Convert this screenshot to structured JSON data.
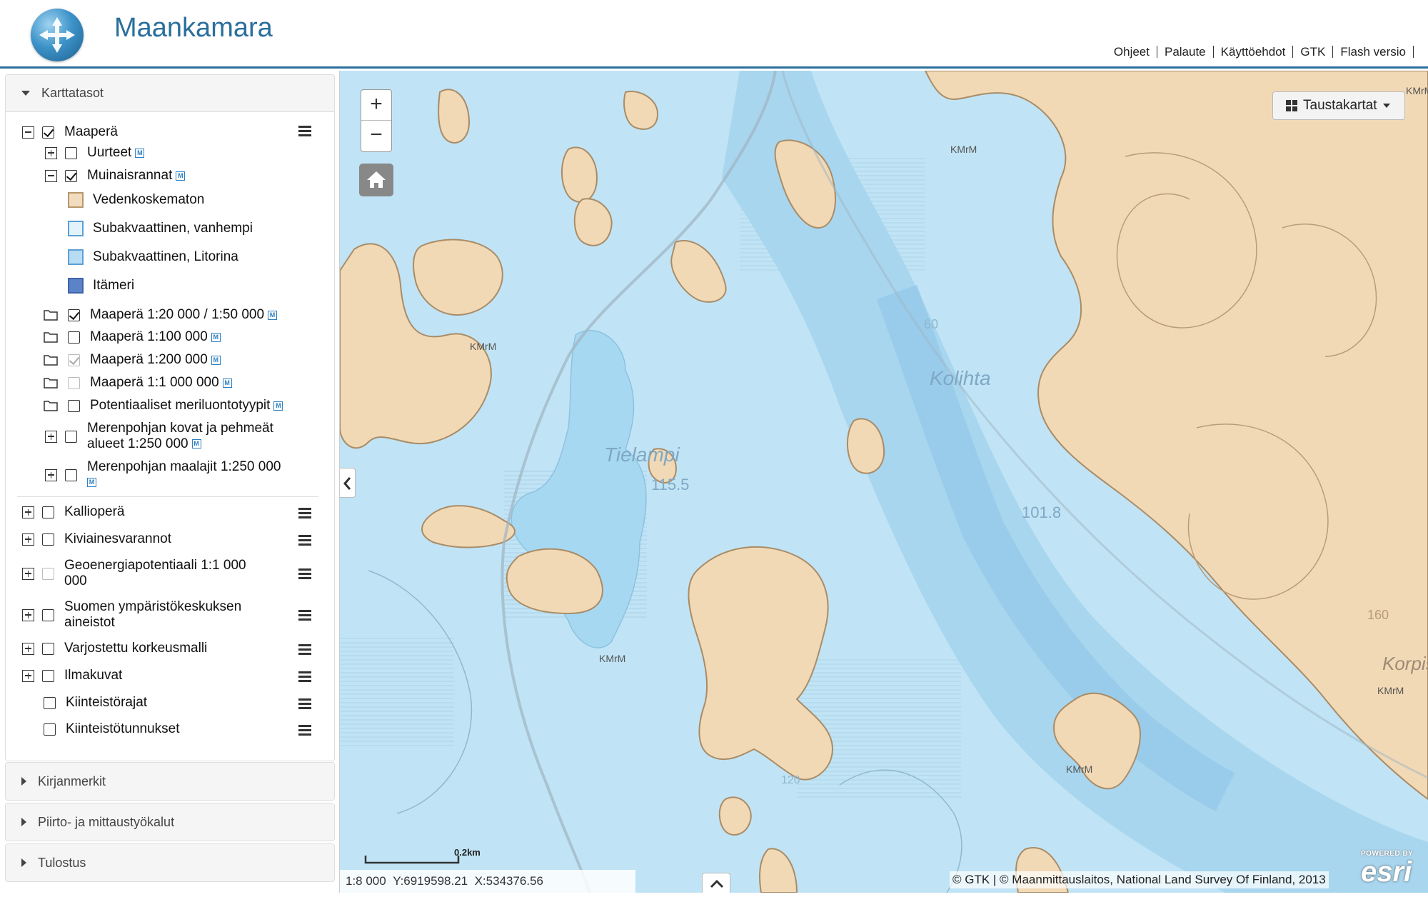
{
  "app": {
    "title": "Maankamara",
    "links": [
      "Ohjeet",
      "Palaute",
      "Käyttöehdot",
      "GTK",
      "Flash versio"
    ]
  },
  "sidebar": {
    "panel_layers": "Karttatasot",
    "panel_bookmarks": "Kirjanmerkit",
    "panel_tools": "Piirto- ja mittaustyökalut",
    "panel_print": "Tulostus",
    "badge": "M",
    "maapera": {
      "label": "Maaperä",
      "uurteet": "Uurteet",
      "muinaisrannat": "Muinaisrannat",
      "legend": [
        {
          "label": "Vedenkoskematon",
          "color": "#f2dcc0",
          "border": "#b7966a"
        },
        {
          "label": "Subakvaattinen, vanhempi",
          "color": "#e2f3fb",
          "border": "#5b9fd6"
        },
        {
          "label": "Subakvaattinen, Litorina",
          "color": "#b7dcf3",
          "border": "#5b9fd6"
        },
        {
          "label": "Itämeri",
          "color": "#5a83c8",
          "border": "#3d64a8"
        }
      ],
      "m20": "Maaperä 1:20 000 / 1:50 000",
      "m100": "Maaperä 1:100 000",
      "m200": "Maaperä 1:200 000",
      "m1000": "Maaperä 1:1 000 000",
      "potentiaaliset": "Potentiaaliset meriluontotyypit",
      "merenpohjan_kovat_1": "Merenpohjan kovat ja pehmeät",
      "merenpohjan_kovat_2": "alueet 1:250 000",
      "merenpohjan_maalajit": "Merenpohjan maalajit 1:250 000"
    },
    "groups": {
      "kalliopera": "Kallioperä",
      "kiviaines": "Kiviainesvarannot",
      "geoenergia_1": "Geoenergiapotentiaali 1:1 000",
      "geoenergia_2": "000",
      "syke_1": "Suomen ympäristökeskuksen",
      "syke_2": "aineistot",
      "varjostettu": "Varjostettu korkeusmalli",
      "ilmakuvat": "Ilmakuvat",
      "kiinteistorajat": "Kiinteistörajat",
      "kiinteistotunnukset": "Kiinteistötunnukset"
    }
  },
  "map": {
    "basemap_button": "Taustakartat",
    "zoom_in": "+",
    "zoom_out": "−",
    "scale_readout": "1:8 000",
    "y_readout": "Y:6919598.21",
    "x_readout": "X:534376.56",
    "scale_bar_label": "0.2km",
    "attribution": "© GTK | © Maanmittauslaitos, National Land Survey Of Finland, 2013",
    "esri_small": "POWERED BY",
    "esri_big": "esri",
    "labels": {
      "kmm1": "KMrM",
      "kmm2": "KMrM",
      "kmm3": "KMrM",
      "kmm4": "KMrM",
      "kmm5": "KMrM",
      "kmm6": "KMrM",
      "tielampi": "Tielampi",
      "tielampi_elev": "115.5",
      "kolihta": "Kolihta",
      "elev1018": "101.8",
      "korpisen": "Korpisen",
      "c160": "160",
      "c60": "60",
      "c120": "120"
    }
  }
}
